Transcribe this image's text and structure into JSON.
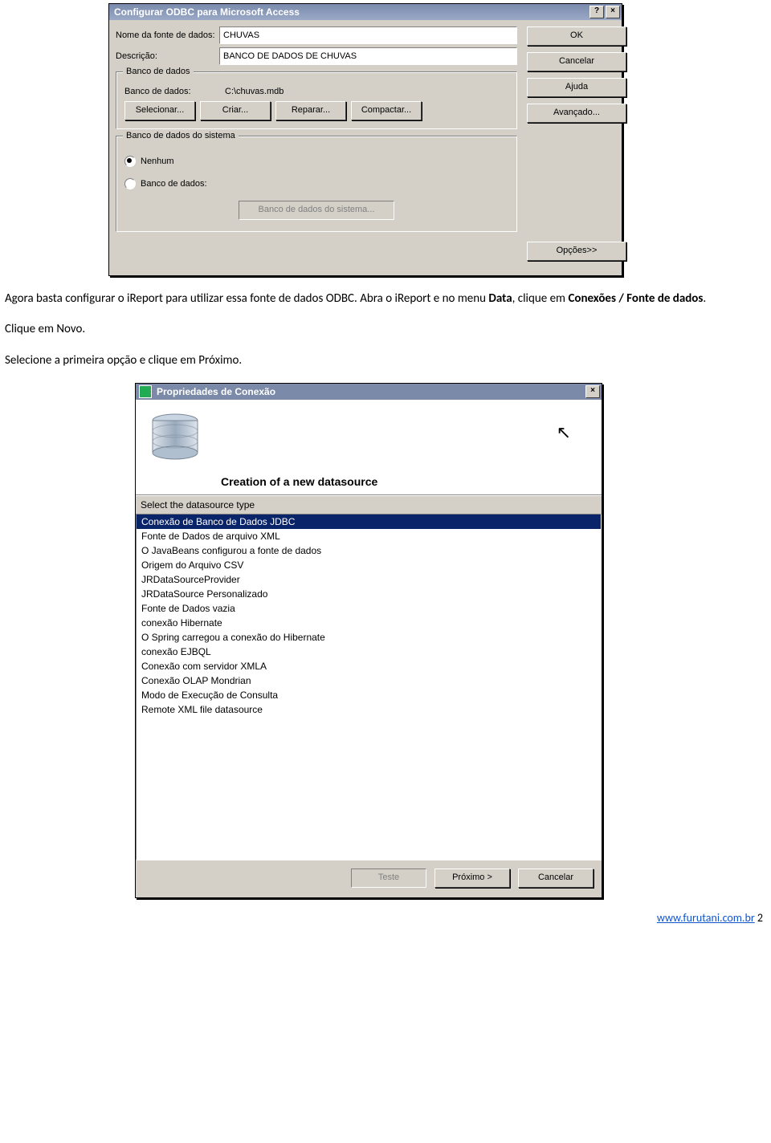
{
  "dlg1": {
    "title": "Configurar ODBC para Microsoft Access",
    "help_btn": "?",
    "close_btn": "×",
    "name_label": "Nome da fonte de dados:",
    "name_value": "CHUVAS",
    "desc_label": "Descrição:",
    "desc_value": "BANCO DE DADOS DE CHUVAS",
    "group_db": "Banco de dados",
    "db_label": "Banco de dados:",
    "db_path": "C:\\chuvas.mdb",
    "btn_select": "Selecionar...",
    "btn_create": "Criar...",
    "btn_repair": "Reparar...",
    "btn_compact": "Compactar...",
    "group_sys": "Banco de dados do sistema",
    "radio_none": "Nenhum",
    "radio_db": "Banco de dados:",
    "btn_sysdb": "Banco de dados do sistema...",
    "side": {
      "ok": "OK",
      "cancel": "Cancelar",
      "help": "Ajuda",
      "advanced": "Avançado...",
      "options": "Opções>>"
    }
  },
  "doc": {
    "p1a": "Agora basta configurar o iReport  para utilizar essa fonte de dados ODBC. Abra o iReport e no menu ",
    "p1b": "Data",
    "p1c": ", clique em ",
    "p1d": "Conexões / Fonte de dados",
    "p1e": ".",
    "p2": "Clique em Novo.",
    "p3": "Selecione a primeira opção e clique em Próximo."
  },
  "dlg2": {
    "title": "Propriedades de Conexão",
    "close_btn": "×",
    "header": "Creation of a new datasource",
    "sub": "Select the datasource type",
    "items": [
      "Conexão de Banco de Dados JDBC",
      "Fonte de Dados de arquivo XML",
      "O JavaBeans configurou a fonte de dados",
      "Origem do Arquivo CSV",
      "JRDataSourceProvider",
      "JRDataSource Personalizado",
      "Fonte de Dados vazia",
      "conexão Hibernate",
      "O Spring carregou a conexão do Hibernate",
      "conexão EJBQL",
      "Conexão com servidor XMLA",
      "Conexão OLAP Mondrian",
      "Modo de Execução de Consulta",
      "Remote XML file datasource"
    ],
    "btn_test": "Teste",
    "btn_next": "Próximo >",
    "btn_cancel": "Cancelar"
  },
  "footer": {
    "url_text": "www.furutani.com.br",
    "page": "2"
  }
}
